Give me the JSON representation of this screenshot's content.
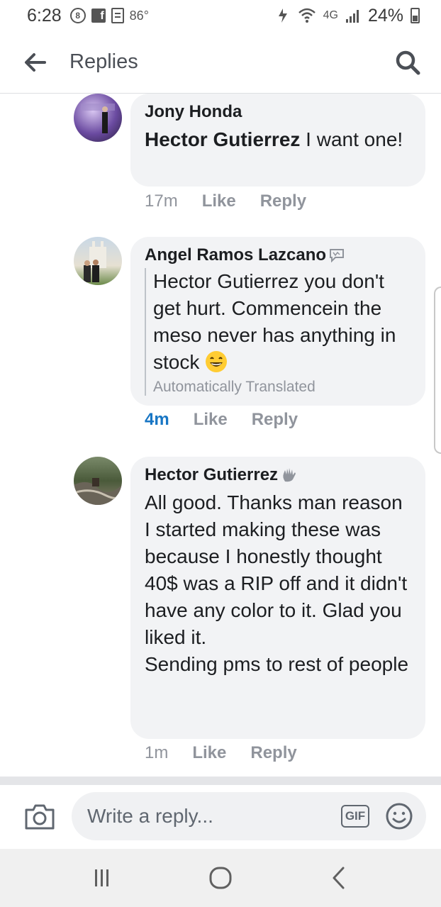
{
  "status_bar": {
    "time": "6:28",
    "temperature": "86°",
    "network": "4G",
    "battery": "24%"
  },
  "header": {
    "title": "Replies"
  },
  "comments": [
    {
      "author": "Jony Honda",
      "mention": "Hector Gutierrez",
      "text": " I want one!",
      "time": "17m",
      "like": "Like",
      "reply": "Reply"
    },
    {
      "author": "Angel Ramos Lazcano",
      "mention": "Hector Gutierrez",
      "text": " you don't get hurt. Commencein the meso never has anything in stock",
      "translated_label": "Automatically Translated",
      "time": "4m",
      "like": "Like",
      "reply": "Reply"
    },
    {
      "author": "Hector Gutierrez",
      "text_lines": [
        "All good. Thanks man reason I started making these was",
        "because I honestly thought 40$ was a RIP off and it didn't have any color to it. Glad you liked it.",
        "Sending pms to rest of people"
      ],
      "time": "1m",
      "like": "Like",
      "reply": "Reply"
    }
  ],
  "reply_box": {
    "placeholder": "Write a reply...",
    "gif_label": "GIF"
  },
  "icons": {
    "back": "arrow-left-icon",
    "search": "search-icon",
    "camera": "camera-icon",
    "emoji": "smiley-icon",
    "translate": "speech-bubble-icon",
    "wave": "waving-hand-icon"
  },
  "colors": {
    "bubble": "#f2f3f5",
    "recent_time": "#1876c4",
    "meta_gray": "#90949c"
  }
}
